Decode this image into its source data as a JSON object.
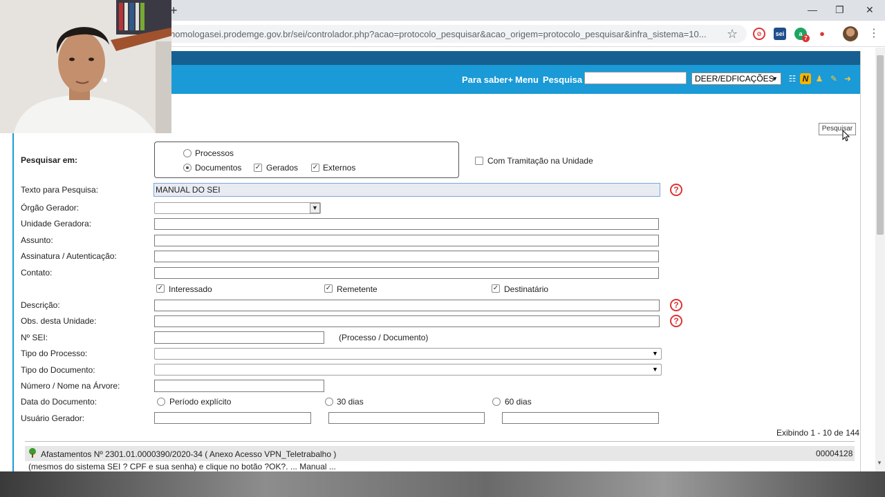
{
  "browser": {
    "new_tab_symbol": "+",
    "minimize": "—",
    "restore": "❐",
    "close": "✕",
    "url": "homologasei.prodemge.gov.br/sei/controlador.php?acao=protocolo_pesquisar&acao_origem=protocolo_pesquisar&infra_sistema=10...",
    "ext_sei_label": "sei",
    "ext_badge_count": "7"
  },
  "header": {
    "nav": [
      "Para saber+",
      "Menu",
      "Pesquisa"
    ],
    "unit_selected": "DEER/EDFICAÇÕES",
    "accent_color": "#1a9ad6"
  },
  "search_button": "Pesquisar",
  "form": {
    "pesquisar_em_label": "Pesquisar em:",
    "opt_processos": "Processos",
    "opt_documentos": "Documentos",
    "opt_gerados": "Gerados",
    "opt_externos": "Externos",
    "opt_tramitacao": "Com Tramitação na Unidade",
    "texto_label": "Texto para Pesquisa:",
    "texto_value": "MANUAL DO SEI",
    "orgao_label": "Órgão Gerador:",
    "unidade_label": "Unidade Geradora:",
    "assunto_label": "Assunto:",
    "assinatura_label": "Assinatura / Autenticação:",
    "contato_label": "Contato:",
    "opt_interessado": "Interessado",
    "opt_remetente": "Remetente",
    "opt_destinatario": "Destinatário",
    "descricao_label": "Descrição:",
    "obs_label": "Obs. desta Unidade:",
    "nsei_label": "Nº SEI:",
    "nsei_hint": "(Processo / Documento)",
    "tipo_processo_label": "Tipo do Processo:",
    "tipo_documento_label": "Tipo do Documento:",
    "numero_nome_label": "Número / Nome na Árvore:",
    "data_label": "Data do Documento:",
    "opt_periodo": "Período explícito",
    "opt_30": "30 dias",
    "opt_60": "60 dias",
    "usuario_label": "Usuário Gerador:",
    "help_symbol": "?"
  },
  "results": {
    "count_text": "Exibindo 1 - 10 de 144",
    "first": {
      "title": "Afastamentos Nº 2301.01.0000390/2020-34 ( Anexo Acesso VPN_Teletrabalho )",
      "id": "00004128",
      "snippet": "(mesmos do sistema SEI ? CPF e sua senha) e clique no botão ?OK?.  ...  Manual  ..."
    }
  }
}
